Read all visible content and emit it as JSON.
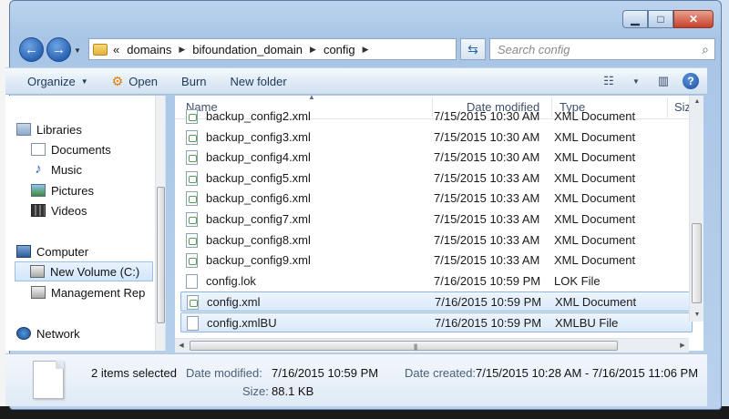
{
  "window": {
    "minimize": "▁",
    "maximize": "□",
    "close": "✕"
  },
  "navigation": {
    "back_glyph": "←",
    "forward_glyph": "→",
    "breadcrumb_prefix": "«",
    "breadcrumb": [
      "domains",
      "bifoundation_domain",
      "config"
    ],
    "search_placeholder": "Search config"
  },
  "toolbar": {
    "organize": "Organize",
    "open": "Open",
    "burn": "Burn",
    "new_folder": "New folder"
  },
  "nav_pane": {
    "libraries": "Libraries",
    "documents": "Documents",
    "music": "Music",
    "pictures": "Pictures",
    "videos": "Videos",
    "computer": "Computer",
    "new_volume": "New Volume (C:)",
    "management": "Management Rep",
    "network": "Network"
  },
  "columns": {
    "name": "Name",
    "date_modified": "Date modified",
    "type": "Type",
    "size": "Size"
  },
  "files": [
    {
      "name": "backup_config2.xml",
      "date": "7/15/2015 10:30 AM",
      "type": "XML Document",
      "kind": "xml",
      "selected": false
    },
    {
      "name": "backup_config3.xml",
      "date": "7/15/2015 10:30 AM",
      "type": "XML Document",
      "kind": "xml",
      "selected": false
    },
    {
      "name": "backup_config4.xml",
      "date": "7/15/2015 10:30 AM",
      "type": "XML Document",
      "kind": "xml",
      "selected": false
    },
    {
      "name": "backup_config5.xml",
      "date": "7/15/2015 10:33 AM",
      "type": "XML Document",
      "kind": "xml",
      "selected": false
    },
    {
      "name": "backup_config6.xml",
      "date": "7/15/2015 10:33 AM",
      "type": "XML Document",
      "kind": "xml",
      "selected": false
    },
    {
      "name": "backup_config7.xml",
      "date": "7/15/2015 10:33 AM",
      "type": "XML Document",
      "kind": "xml",
      "selected": false
    },
    {
      "name": "backup_config8.xml",
      "date": "7/15/2015 10:33 AM",
      "type": "XML Document",
      "kind": "xml",
      "selected": false
    },
    {
      "name": "backup_config9.xml",
      "date": "7/15/2015 10:33 AM",
      "type": "XML Document",
      "kind": "xml",
      "selected": false
    },
    {
      "name": "config.lok",
      "date": "7/16/2015 10:59 PM",
      "type": "LOK File",
      "kind": "plain",
      "selected": false
    },
    {
      "name": "config.xml",
      "date": "7/16/2015 10:59 PM",
      "type": "XML Document",
      "kind": "xml",
      "selected": true
    },
    {
      "name": "config.xmlBU",
      "date": "7/16/2015 10:59 PM",
      "type": "XMLBU File",
      "kind": "plain",
      "selected": true
    }
  ],
  "details": {
    "selection": "2 items selected",
    "date_modified_label": "Date modified:",
    "date_modified_value": "7/16/2015 10:59 PM",
    "size_label": "Size:",
    "size_value": "88.1 KB",
    "date_created_label": "Date created:",
    "date_created_value": "7/15/2015 10:28 AM - 7/16/2015 11:06 PM"
  }
}
